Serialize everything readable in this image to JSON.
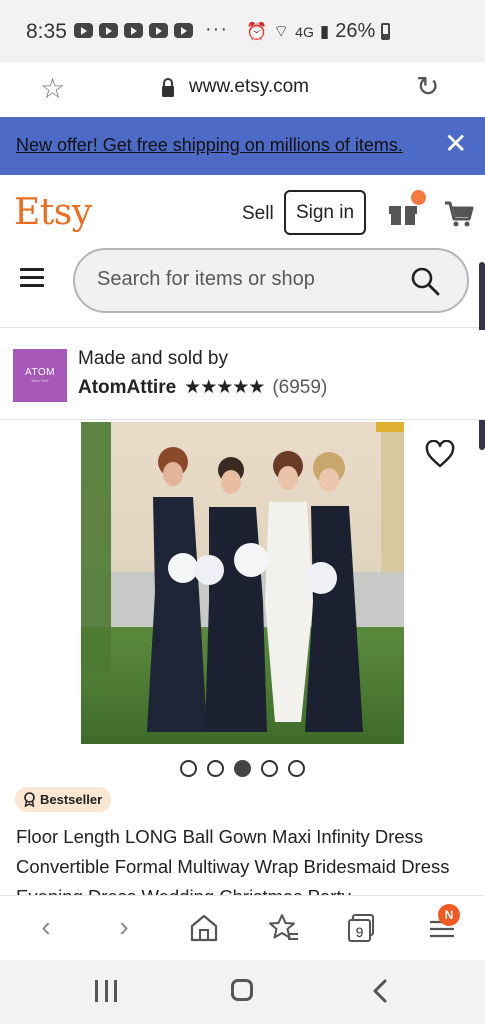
{
  "status_bar": {
    "time": "8:35",
    "notification_icons": [
      "youtube-icon",
      "youtube-icon",
      "youtube-icon",
      "youtube-icon",
      "youtube-icon"
    ],
    "overflow": "···",
    "network": "4G",
    "battery": "26%"
  },
  "browser": {
    "url": "www.etsy.com"
  },
  "offer_banner": {
    "text": "New offer! Get free shipping on millions of items."
  },
  "header": {
    "logo": "Etsy",
    "sell_label": "Sell",
    "signin_label": "Sign in",
    "search_placeholder": "Search for items or shop"
  },
  "shop": {
    "avatar_text": "ATOM",
    "avatar_subtext": "New York",
    "made_by": "Made and sold by",
    "name": "AtomAttire",
    "stars": "★★★★★",
    "rating": 5,
    "reviews": "(6959)"
  },
  "listing": {
    "image_count": 5,
    "active_image": 3,
    "badge": "Bestseller",
    "title": "Floor Length LONG Ball Gown Maxi Infinity Dress Convertible Formal Multiway Wrap Bridesmaid Dress Evening Dress Wedding Christmas Party"
  },
  "toolbar": {
    "tabs_count": "9",
    "menu_badge": "N"
  },
  "colors": {
    "brand": "#eb6d20",
    "banner": "#4d6bc6",
    "avatar": "#a658b8",
    "badge_bg": "#fae7d2"
  }
}
